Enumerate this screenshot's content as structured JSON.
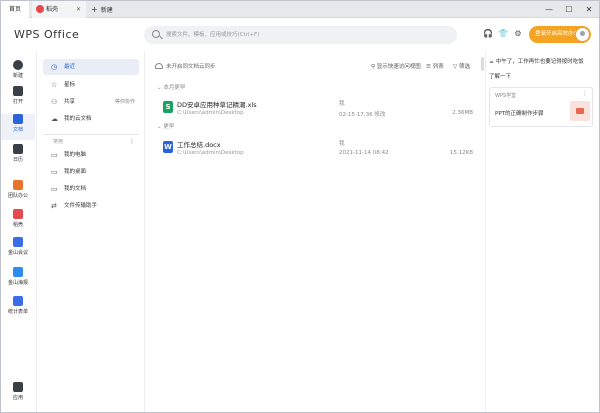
{
  "titlebar": {
    "tabs": [
      {
        "label": "首页"
      },
      {
        "label": "稻壳"
      },
      {
        "label": "新建"
      }
    ],
    "window_controls": [
      "—",
      "☐",
      "✕"
    ]
  },
  "header": {
    "logo": "WPS Office",
    "search_placeholder": "搜索文件、模板、应用或技巧(Ctrl+F)",
    "vip_button": "登录开启高效办公"
  },
  "rail": [
    {
      "label": "新建",
      "icon": "plus-icon"
    },
    {
      "label": "打开",
      "icon": "folder-icon"
    },
    {
      "label": "文档",
      "icon": "document-icon"
    },
    {
      "label": "日历",
      "icon": "calendar-icon"
    },
    {
      "label": "团队办公",
      "icon": "team-icon"
    },
    {
      "label": "稻壳",
      "icon": "docer-icon"
    },
    {
      "label": "金山会议",
      "icon": "meeting-icon"
    },
    {
      "label": "金山海报",
      "icon": "poster-icon"
    },
    {
      "label": "统计表单",
      "icon": "form-icon"
    },
    {
      "label": "应用",
      "icon": "apps-icon"
    }
  ],
  "nav": {
    "items": [
      {
        "label": "最近"
      },
      {
        "label": "星标"
      },
      {
        "label": "共享",
        "extra": "等你协作"
      },
      {
        "label": "我的云文档"
      }
    ],
    "common_title": "常用",
    "common": [
      {
        "label": "我的电脑"
      },
      {
        "label": "我的桌面"
      },
      {
        "label": "我的文档"
      },
      {
        "label": "文件传输助手"
      }
    ]
  },
  "main": {
    "cloud_notice": "未开启同文档云同步",
    "tools": {
      "quick": "显示快速访问视图",
      "list": "列表",
      "filter": "筛选"
    },
    "sections": [
      {
        "title": "本月更早",
        "files": [
          {
            "name": "DD安卓应用种草记精潮.xls",
            "path": "C:\\Users\\admin\\Desktop",
            "owner": "我",
            "time": "02-15 17:36 修改",
            "size": "2.36MB",
            "type": "S"
          }
        ]
      },
      {
        "title": "更早",
        "files": [
          {
            "name": "工作总结.docx",
            "path": "C:\\Users\\admin\\Desktop",
            "owner": "我",
            "time": "2021-11-14 08:42",
            "size": "15.12KB",
            "type": "W"
          }
        ]
      }
    ]
  },
  "right_panel": {
    "greeting": "中午了，工作再忙也要记得按时吃饭",
    "more": "了解一下",
    "card": {
      "title": "WPS学堂",
      "desc": "PPT的正确制作步骤"
    }
  },
  "colors": {
    "accent": "#2b63d9",
    "vip": "#f4a422",
    "sheet": "#1aa461",
    "writer": "#2b63d9"
  }
}
